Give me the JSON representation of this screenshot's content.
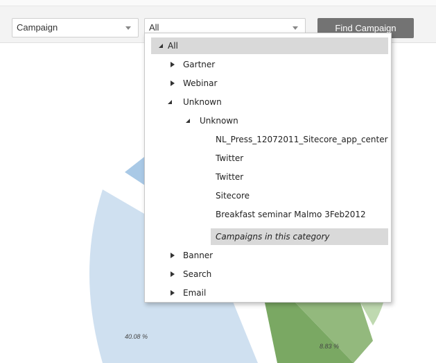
{
  "toolbar": {
    "campaign_select": "Campaign",
    "filter_select": "All",
    "find_button": "Find Campaign"
  },
  "chart": {
    "slices": [
      {
        "label": "40.08 %",
        "color": "#cfe0f0"
      },
      {
        "label": "",
        "color": "#a9c9e6"
      },
      {
        "label": "8.83 %",
        "color": "#7aa863"
      },
      {
        "label": "",
        "color": "#bfd9b0"
      }
    ]
  },
  "tree": {
    "items": [
      {
        "label": "All",
        "expanded": true,
        "selected": true
      },
      {
        "label": "Gartner",
        "expanded": false
      },
      {
        "label": "Webinar",
        "expanded": false
      },
      {
        "label": "Unknown",
        "expanded": true
      },
      {
        "label": "Unknown",
        "expanded": true
      },
      {
        "label": "NL_Press_12072011_Sitecore_app_center"
      },
      {
        "label": "Twitter"
      },
      {
        "label": "Twitter"
      },
      {
        "label": "Sitecore"
      },
      {
        "label": "Breakfast seminar Malmo 3Feb2012"
      },
      {
        "label": "Campaigns in this category",
        "selected": true
      },
      {
        "label": "Banner",
        "expanded": false
      },
      {
        "label": "Search",
        "expanded": false
      },
      {
        "label": "Email",
        "expanded": false
      }
    ]
  }
}
